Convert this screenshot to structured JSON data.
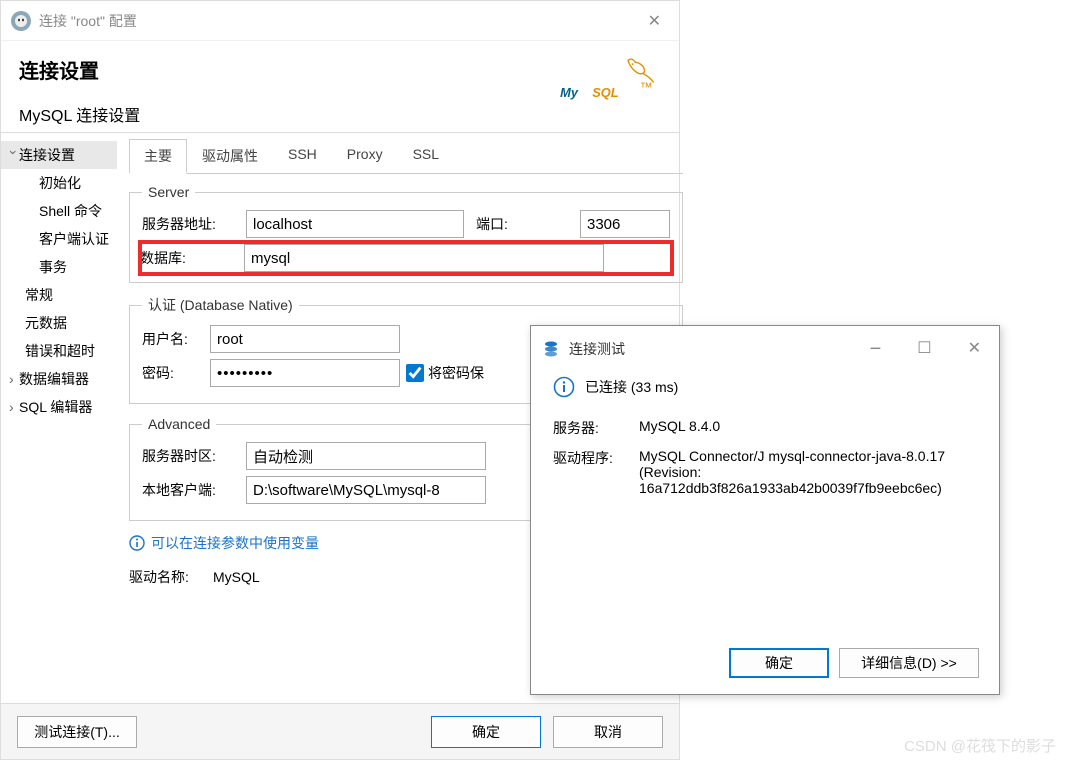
{
  "window": {
    "title": "连接 \"root\" 配置"
  },
  "header": {
    "title": "连接设置",
    "subtitle": "MySQL 连接设置"
  },
  "nav": {
    "items": [
      {
        "label": "连接设置",
        "kind": "expandable selected"
      },
      {
        "label": "初始化",
        "kind": "child"
      },
      {
        "label": "Shell 命令",
        "kind": "child"
      },
      {
        "label": "客户端认证",
        "kind": "child"
      },
      {
        "label": "事务",
        "kind": "child"
      },
      {
        "label": "常规",
        "kind": "child2"
      },
      {
        "label": "元数据",
        "kind": "child2"
      },
      {
        "label": "错误和超时",
        "kind": "child2"
      },
      {
        "label": "数据编辑器",
        "kind": "collapsed"
      },
      {
        "label": "SQL 编辑器",
        "kind": "collapsed"
      }
    ]
  },
  "tabs": [
    {
      "label": "主要",
      "active": true
    },
    {
      "label": "驱动属性",
      "active": false
    },
    {
      "label": "SSH",
      "active": false
    },
    {
      "label": "Proxy",
      "active": false
    },
    {
      "label": "SSL",
      "active": false
    }
  ],
  "server_group": {
    "legend": "Server",
    "host_label": "服务器地址:",
    "host_value": "localhost",
    "port_label": "端口:",
    "port_value": "3306",
    "database_label": "数据库:",
    "database_value": "mysql"
  },
  "auth_group": {
    "legend": "认证 (Database Native)",
    "user_label": "用户名:",
    "user_value": "root",
    "password_label": "密码:",
    "password_value": "•••••••••",
    "save_password_label": "将密码保"
  },
  "advanced_group": {
    "legend": "Advanced",
    "timezone_label": "服务器时区:",
    "timezone_value": "自动检测",
    "local_client_label": "本地客户端:",
    "local_client_value": "D:\\software\\MySQL\\mysql-8"
  },
  "info_tip": "可以在连接参数中使用变量",
  "driver_row": {
    "label": "驱动名称:",
    "value": "MySQL"
  },
  "bottom_bar": {
    "test": "测试连接(T)...",
    "ok": "确定",
    "cancel": "取消"
  },
  "modal": {
    "title": "连接测试",
    "status": "已连接 (33 ms)",
    "server_label": "服务器:",
    "server_value": "MySQL 8.4.0",
    "driver_label": "驱动程序:",
    "driver_value": "MySQL Connector/J mysql-connector-java-8.0.17 (Revision: 16a712ddb3f826a1933ab42b0039f7fb9eebc6ec)",
    "ok": "确定",
    "details": "详细信息(D) >>"
  },
  "watermark": "CSDN @花筏下的影子"
}
